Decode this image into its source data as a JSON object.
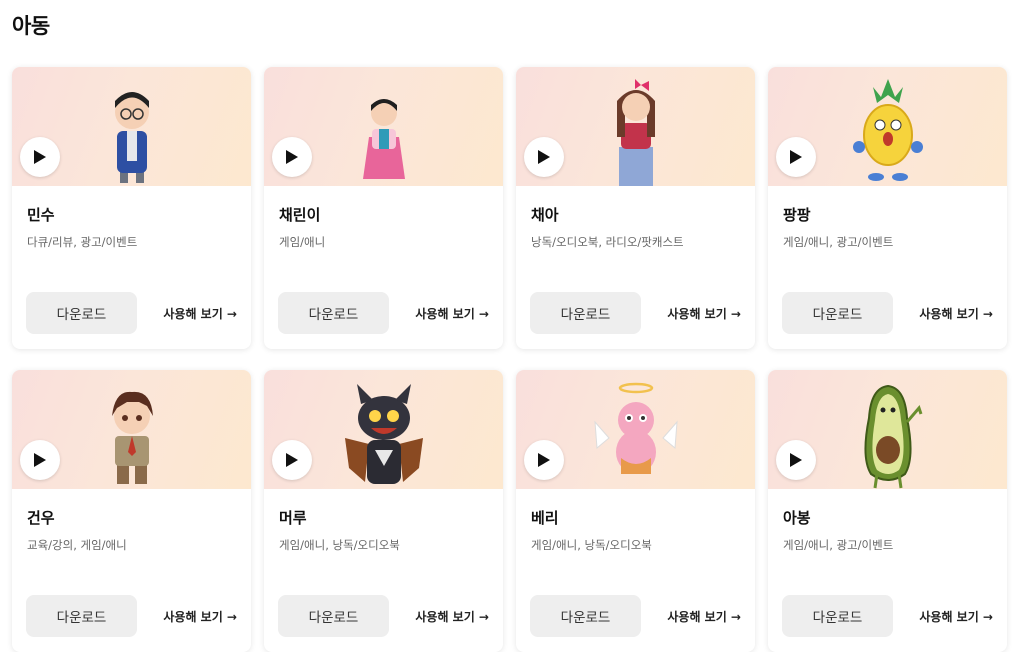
{
  "page": {
    "title": "아동"
  },
  "labels": {
    "download": "다운로드",
    "usage": "사용해 보기 →"
  },
  "colors": {
    "banner_start": "#f9dfdc",
    "banner_end": "#fde8cf",
    "button_bg": "#eeeeee"
  },
  "cards": [
    {
      "name": "민수",
      "tags": "다큐/리뷰, 광고/이벤트",
      "character": "boy-glasses"
    },
    {
      "name": "채린이",
      "tags": "게임/애니",
      "character": "girl-hanbok"
    },
    {
      "name": "채아",
      "tags": "낭독/오디오북, 라디오/팟캐스트",
      "character": "girl-bow"
    },
    {
      "name": "팡팡",
      "tags": "게임/애니, 광고/이벤트",
      "character": "pineapple"
    },
    {
      "name": "건우",
      "tags": "교육/강의, 게임/애니",
      "character": "boy-scout"
    },
    {
      "name": "머루",
      "tags": "게임/애니, 낭독/오디오북",
      "character": "cat-monster"
    },
    {
      "name": "베리",
      "tags": "게임/애니, 낭독/오디오북",
      "character": "pink-angel"
    },
    {
      "name": "아봉",
      "tags": "게임/애니, 광고/이벤트",
      "character": "avocado"
    }
  ]
}
